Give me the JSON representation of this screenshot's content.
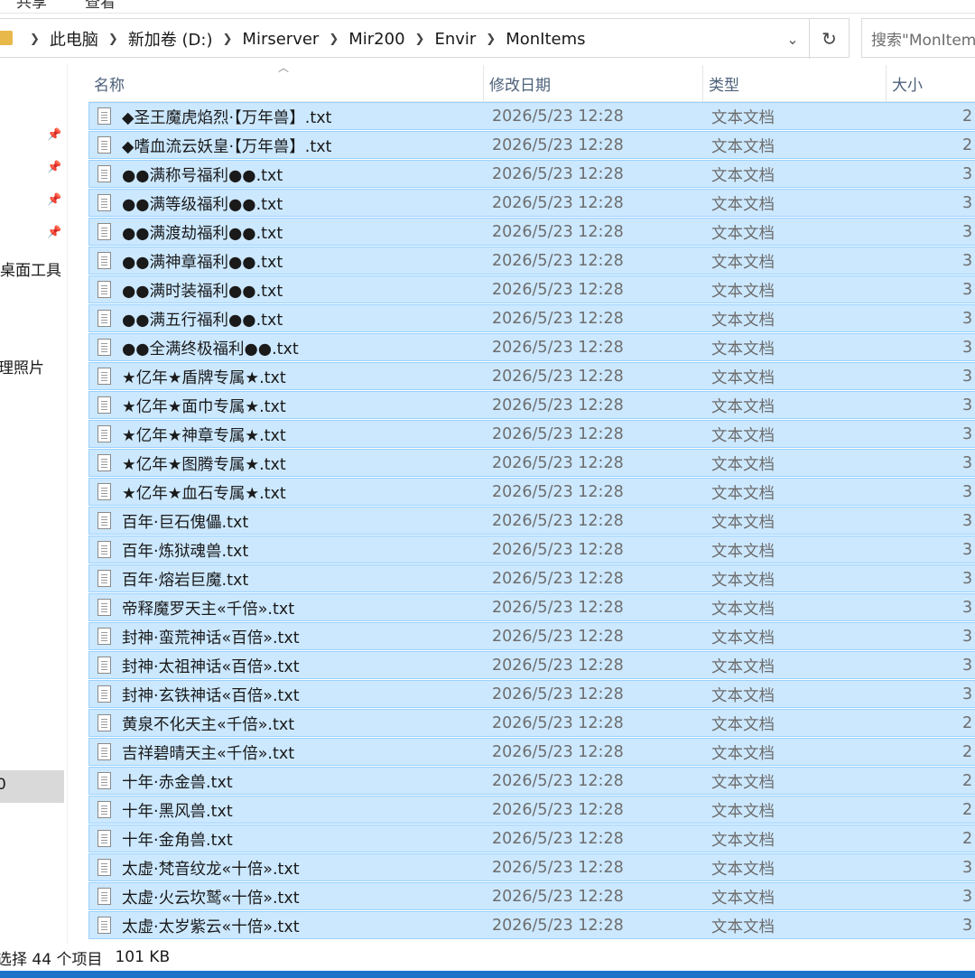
{
  "ribbon": {
    "tabs": [
      "共享",
      "查看"
    ]
  },
  "address": {
    "crumbs": [
      "此电脑",
      "新加卷 (D:)",
      "Mirserver",
      "Mir200",
      "Envir",
      "MonItems"
    ],
    "search_placeholder": "搜索\"MonItems\""
  },
  "nav": {
    "desktop_tools": "桌面工具",
    "photos": "理照片",
    "selected_item": "0"
  },
  "columns": {
    "name": "名称",
    "date": "修改日期",
    "type": "类型",
    "size": "大小"
  },
  "files": [
    {
      "name": "◆圣王魔虎焰烈·【万年兽】.txt",
      "date": "2026/5/23 12:28",
      "type": "文本文档",
      "size": "2"
    },
    {
      "name": "◆嗜血流云妖皇·【万年兽】.txt",
      "date": "2026/5/23 12:28",
      "type": "文本文档",
      "size": "2"
    },
    {
      "name": "●●满称号福利●●.txt",
      "date": "2026/5/23 12:28",
      "type": "文本文档",
      "size": "3"
    },
    {
      "name": "●●满等级福利●●.txt",
      "date": "2026/5/23 12:28",
      "type": "文本文档",
      "size": "3"
    },
    {
      "name": "●●满渡劫福利●●.txt",
      "date": "2026/5/23 12:28",
      "type": "文本文档",
      "size": "3"
    },
    {
      "name": "●●满神章福利●●.txt",
      "date": "2026/5/23 12:28",
      "type": "文本文档",
      "size": "3"
    },
    {
      "name": "●●满时装福利●●.txt",
      "date": "2026/5/23 12:28",
      "type": "文本文档",
      "size": "3"
    },
    {
      "name": "●●满五行福利●●.txt",
      "date": "2026/5/23 12:28",
      "type": "文本文档",
      "size": "3"
    },
    {
      "name": "●●全满终极福利●●.txt",
      "date": "2026/5/23 12:28",
      "type": "文本文档",
      "size": "3"
    },
    {
      "name": "★亿年★盾牌专属★.txt",
      "date": "2026/5/23 12:28",
      "type": "文本文档",
      "size": "3"
    },
    {
      "name": "★亿年★面巾专属★.txt",
      "date": "2026/5/23 12:28",
      "type": "文本文档",
      "size": "3"
    },
    {
      "name": "★亿年★神章专属★.txt",
      "date": "2026/5/23 12:28",
      "type": "文本文档",
      "size": "3"
    },
    {
      "name": "★亿年★图腾专属★.txt",
      "date": "2026/5/23 12:28",
      "type": "文本文档",
      "size": "3"
    },
    {
      "name": "★亿年★血石专属★.txt",
      "date": "2026/5/23 12:28",
      "type": "文本文档",
      "size": "3"
    },
    {
      "name": "百年·巨石傀儡.txt",
      "date": "2026/5/23 12:28",
      "type": "文本文档",
      "size": "3"
    },
    {
      "name": "百年·炼狱魂兽.txt",
      "date": "2026/5/23 12:28",
      "type": "文本文档",
      "size": "3"
    },
    {
      "name": "百年·熔岩巨魔.txt",
      "date": "2026/5/23 12:28",
      "type": "文本文档",
      "size": "3"
    },
    {
      "name": "帝释魔罗天主«千倍».txt",
      "date": "2026/5/23 12:28",
      "type": "文本文档",
      "size": "3"
    },
    {
      "name": "封神·蛮荒神话«百倍».txt",
      "date": "2026/5/23 12:28",
      "type": "文本文档",
      "size": "3"
    },
    {
      "name": "封神·太祖神话«百倍».txt",
      "date": "2026/5/23 12:28",
      "type": "文本文档",
      "size": "3"
    },
    {
      "name": "封神·玄铁神话«百倍».txt",
      "date": "2026/5/23 12:28",
      "type": "文本文档",
      "size": "3"
    },
    {
      "name": "黄泉不化天主«千倍».txt",
      "date": "2026/5/23 12:28",
      "type": "文本文档",
      "size": "2"
    },
    {
      "name": "吉祥碧晴天主«千倍».txt",
      "date": "2026/5/23 12:28",
      "type": "文本文档",
      "size": "2"
    },
    {
      "name": "十年·赤金兽.txt",
      "date": "2026/5/23 12:28",
      "type": "文本文档",
      "size": "2"
    },
    {
      "name": "十年·黑风兽.txt",
      "date": "2026/5/23 12:28",
      "type": "文本文档",
      "size": "2"
    },
    {
      "name": "十年·金角兽.txt",
      "date": "2026/5/23 12:28",
      "type": "文本文档",
      "size": "2"
    },
    {
      "name": "太虚·梵音纹龙«十倍».txt",
      "date": "2026/5/23 12:28",
      "type": "文本文档",
      "size": "3"
    },
    {
      "name": "太虚·火云坎鹫«十倍».txt",
      "date": "2026/5/23 12:28",
      "type": "文本文档",
      "size": "3"
    },
    {
      "name": "太虚·太岁紫云«十倍».txt",
      "date": "2026/5/23 12:28",
      "type": "文本文档",
      "size": "3"
    }
  ],
  "status": {
    "selection": "选择 44 个项目",
    "size": "101 KB"
  },
  "colors": {
    "selection_bg": "#cce8ff",
    "selection_border": "#99d1ff",
    "header_text": "#4c607a"
  }
}
